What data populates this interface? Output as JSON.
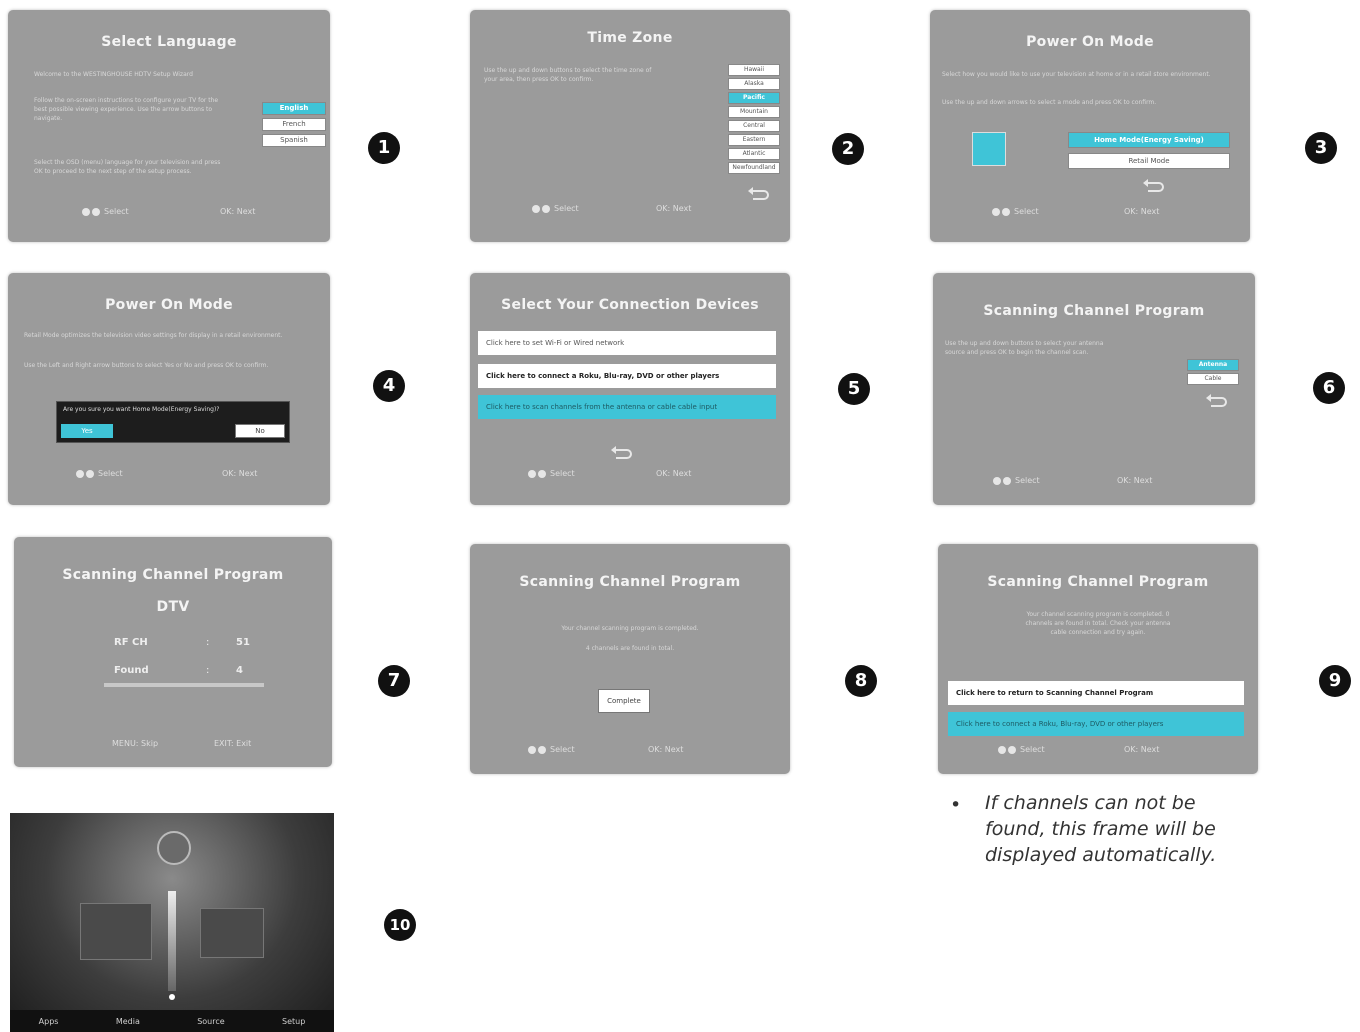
{
  "steps": [
    "1",
    "2",
    "3",
    "4",
    "5",
    "6",
    "7",
    "8",
    "9",
    "10"
  ],
  "common": {
    "select": "Select",
    "ok_next": "OK: Next"
  },
  "s1": {
    "title": "Select Language",
    "desc1": "Welcome to the WESTINGHOUSE HDTV Setup Wizard",
    "desc2": "Follow the on-screen instructions to configure your TV for the best possible viewing experience. Use the arrow buttons to navigate.",
    "desc3": "Select the OSD (menu) language for your television and press OK to proceed to the next step of the setup process.",
    "options": [
      "English",
      "French",
      "Spanish"
    ]
  },
  "s2": {
    "title": "Time Zone",
    "desc": "Use the up and down buttons to select the time zone of your area, then press OK to confirm.",
    "options": [
      "Hawaii",
      "Alaska",
      "Pacific",
      "Mountain",
      "Central",
      "Eastern",
      "Atlantic",
      "Newfoundland"
    ]
  },
  "s3": {
    "title": "Power On Mode",
    "desc1": "Select how you would like to use your television at home or in a retail store environment.",
    "desc2": "Use the up and down arrows to select a mode and press OK to confirm.",
    "options": [
      "Home Mode(Energy Saving)",
      "Retail Mode"
    ]
  },
  "s4": {
    "title": "Power On Mode",
    "desc1": "Retail Mode optimizes the television video settings for display in a retail environment.",
    "desc2": "Use the Left and Right arrow buttons to select Yes or No and press OK to confirm.",
    "dialog": "Are you sure you want Home Mode(Energy Saving)?",
    "yes": "Yes",
    "no": "No"
  },
  "s5": {
    "title": "Select Your Connection Devices",
    "rows": [
      "Click here to set Wi-Fi or Wired network",
      "Click here to connect a Roku, Blu-ray, DVD or other players",
      "Click here to scan channels from the antenna or cable cable input"
    ]
  },
  "s6": {
    "title": "Scanning Channel Program",
    "desc": "Use the up and down buttons to select your antenna source and press OK to begin the channel scan.",
    "options": [
      "Antenna",
      "Cable"
    ]
  },
  "s7": {
    "title": "Scanning Channel Program",
    "subtitle": "DTV",
    "rf_label": "RF CH",
    "rf_value": "51",
    "found_label": "Found",
    "found_value": "4",
    "colon": ":",
    "menu_hint": "MENU: Skip",
    "exit_hint": "EXIT: Exit"
  },
  "s8": {
    "title": "Scanning Channel Program",
    "desc1": "Your channel scanning program is completed.",
    "desc2": "4 channels are found in total.",
    "button": "Complete"
  },
  "s9": {
    "title": "Scanning Channel Program",
    "desc": "Your channel scanning program is completed. 0 channels are found in total. Check your antenna cable connection and try again.",
    "rows": [
      "Click here to return to Scanning Channel Program",
      "Click here to connect a Roku, Blu-ray, DVD or other players"
    ]
  },
  "note": {
    "bullet": "•",
    "text": "If channels can not be found, this frame will be displayed automatically."
  },
  "s10": {
    "labels": [
      "Apps",
      "Media",
      "Source",
      "Setup"
    ]
  },
  "colors": {
    "accent": "#3fc4d7",
    "screen": "#9b9b9b"
  }
}
